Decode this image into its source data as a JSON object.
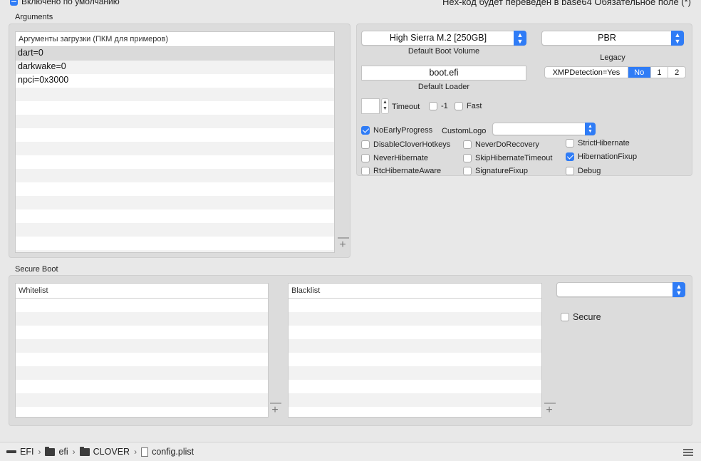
{
  "top": {
    "default_enabled_label": "Включено по умолчанию",
    "hex_note": "Hex-код будет переведен в base64   Обязательное поле (*)"
  },
  "arguments": {
    "section_title": "Arguments",
    "table_header": "Аргументы загрузки (ПКМ для примеров)",
    "rows": [
      "dart=0",
      "darkwake=0",
      "npci=0x3000"
    ]
  },
  "boot": {
    "default_volume_value": "High Sierra M.2 [250GB]",
    "default_volume_caption": "Default Boot Volume",
    "legacy_value": "PBR",
    "legacy_caption": "Legacy",
    "default_loader_value": "boot.efi",
    "default_loader_caption": "Default Loader",
    "xmp_label": "XMPDetection=Yes",
    "xmp_options": [
      "No",
      "1",
      "2"
    ],
    "xmp_selected": "No",
    "timeout_label": "Timeout",
    "timeout_value": "",
    "minus_one_label": "-1",
    "fast_label": "Fast",
    "custom_logo_label": "CustomLogo",
    "custom_logo_value": "",
    "checkboxes": {
      "no_early_progress": {
        "label": "NoEarlyProgress",
        "checked": true
      },
      "disable_clover_hotkeys": {
        "label": "DisableCloverHotkeys",
        "checked": false
      },
      "never_do_recovery": {
        "label": "NeverDoRecovery",
        "checked": false
      },
      "strict_hibernate": {
        "label": "StrictHibernate",
        "checked": false
      },
      "never_hibernate": {
        "label": "NeverHibernate",
        "checked": false
      },
      "skip_hibernate_timeout": {
        "label": "SkipHibernateTimeout",
        "checked": false
      },
      "hibernation_fixup": {
        "label": "HibernationFixup",
        "checked": true
      },
      "rtc_hibernate_aware": {
        "label": "RtcHibernateAware",
        "checked": false
      },
      "signature_fixup": {
        "label": "SignatureFixup",
        "checked": false
      },
      "debug": {
        "label": "Debug",
        "checked": false
      }
    }
  },
  "secure_boot": {
    "section_title": "Secure Boot",
    "whitelist_header": "Whitelist",
    "blacklist_header": "Blacklist",
    "policy_value": "",
    "secure_label": "Secure"
  },
  "statusbar": {
    "path": [
      "EFI",
      "efi",
      "CLOVER",
      "config.plist"
    ]
  },
  "colors": {
    "accent": "#2f7cf6",
    "background": "#e8e8e8",
    "group": "#dcdcdc"
  }
}
